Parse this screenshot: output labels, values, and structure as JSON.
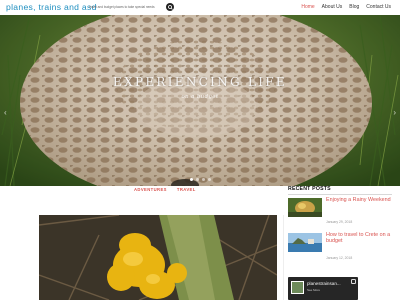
{
  "header": {
    "site_title": "planes, trains and asd",
    "tagline": "travel and budget places to take special needs",
    "nav": [
      "Home",
      "About Us",
      "Blog",
      "Contact Us"
    ]
  },
  "hero": {
    "title": "EXPERIENCING LIFE",
    "subtitle": "on a budget",
    "slide_count": 4,
    "active_slide": 1
  },
  "post": {
    "categories": [
      "ADVENTURES",
      "TRAVEL"
    ]
  },
  "sidebar": {
    "recent_posts_title": "RECENT POSTS",
    "recent_posts": [
      {
        "title": "Enjoying a Rainy Weekend",
        "date": "January 29, 2018"
      },
      {
        "title": "How to travel to Crete on a budget",
        "date": "January 12, 2018"
      }
    ],
    "instagram": {
      "name": "planestrainsan...",
      "link": "See More"
    }
  },
  "colors": {
    "accent": "#d9534f",
    "title_blue": "#1f8fc0"
  }
}
